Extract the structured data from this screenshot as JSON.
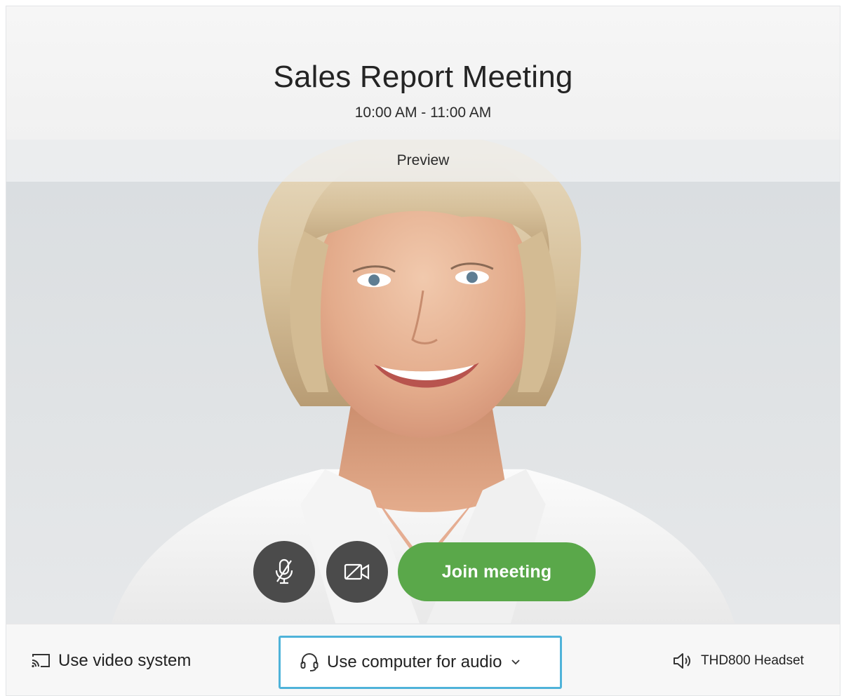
{
  "meeting": {
    "title": "Sales Report Meeting",
    "time": "10:00 AM - 11:00 AM",
    "preview_label": "Preview"
  },
  "controls": {
    "mute_icon": "microphone-muted-icon",
    "video_icon": "video-off-icon",
    "join_label": "Join meeting",
    "join_color": "#5aa84a",
    "circle_color": "#4b4b4b"
  },
  "bottom_bar": {
    "video_system_label": "Use video system",
    "video_system_icon": "cast-screen-icon",
    "audio_label": "Use computer for audio",
    "audio_icon": "headset-icon",
    "audio_dropdown_icon": "chevron-down-icon",
    "audio_focus_color": "#4fb3d9",
    "speaker_label": "THD800 Headset",
    "speaker_icon": "speaker-icon"
  }
}
